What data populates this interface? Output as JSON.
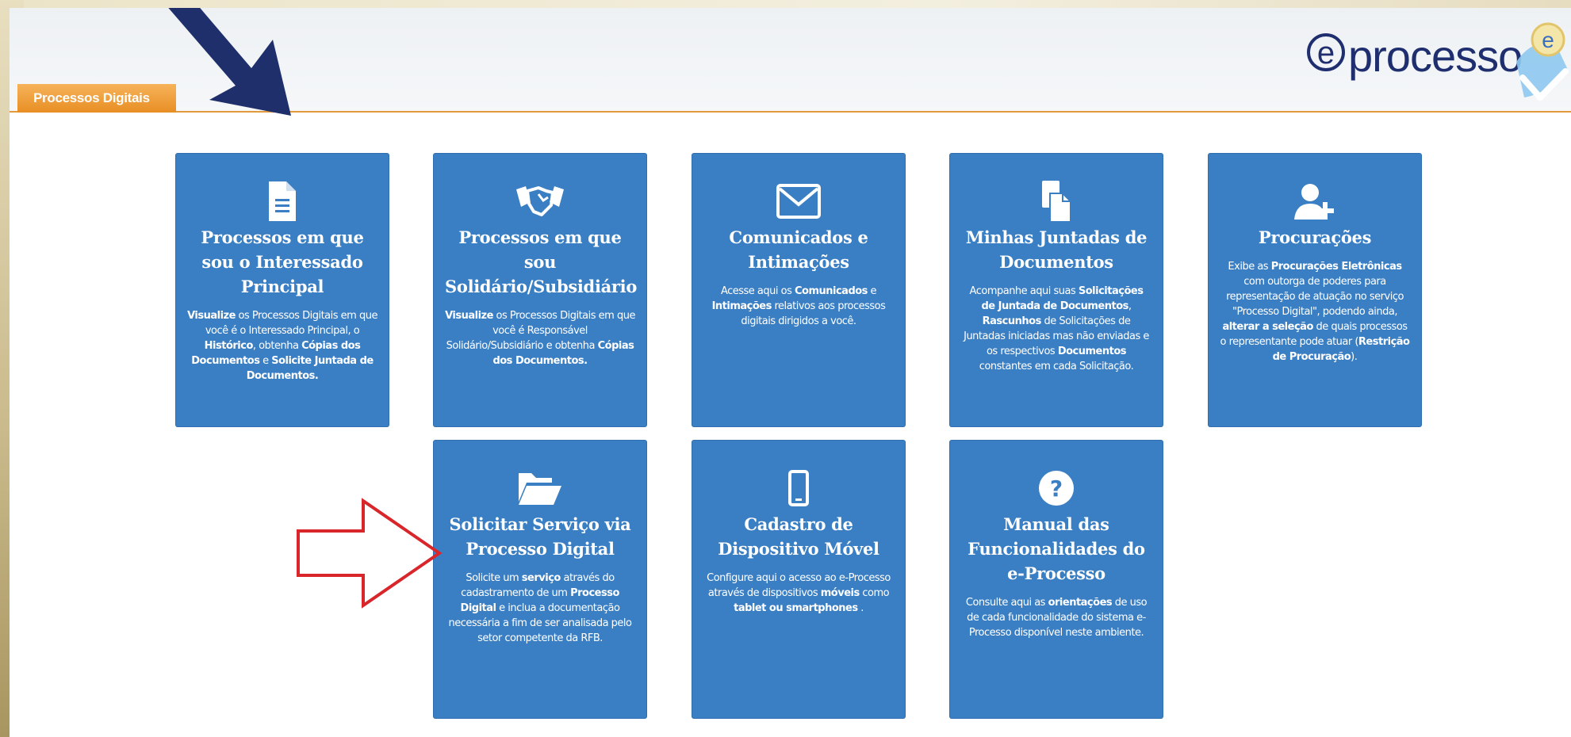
{
  "tab": {
    "label": "Processos Digitais"
  },
  "logo": {
    "text": "eprocesso"
  },
  "cards": [
    {
      "title": "Processos em que sou o Interessado Principal",
      "desc": [
        {
          "t": "Visualize",
          "b": true
        },
        {
          "t": " os Processos Digitais em que você é o Interessado Principal, o ",
          "b": false
        },
        {
          "t": "Histórico",
          "b": true
        },
        {
          "t": ", obtenha ",
          "b": false
        },
        {
          "t": "Cópias dos Documentos",
          "b": true
        },
        {
          "t": " e ",
          "b": false
        },
        {
          "t": "Solicite Juntada de Documentos.",
          "b": true
        }
      ]
    },
    {
      "title": "Processos em que sou Solidário/Subsidiário",
      "desc": [
        {
          "t": "Visualize",
          "b": true
        },
        {
          "t": " os Processos Digitais em que você é Responsável Solidário/Subsidiário e obtenha ",
          "b": false
        },
        {
          "t": "Cópias dos Documentos.",
          "b": true
        }
      ]
    },
    {
      "title": "Comunicados e Intimações",
      "desc": [
        {
          "t": "Acesse aqui os ",
          "b": false
        },
        {
          "t": "Comunicados",
          "b": true
        },
        {
          "t": " e ",
          "b": false
        },
        {
          "t": "Intimações",
          "b": true
        },
        {
          "t": " relativos aos processos digitais dirigidos a você.",
          "b": false
        }
      ]
    },
    {
      "title": "Minhas Juntadas de Documentos",
      "desc": [
        {
          "t": "Acompanhe aqui suas ",
          "b": false
        },
        {
          "t": "Solicitações de Juntada de Documentos",
          "b": true
        },
        {
          "t": ", ",
          "b": false
        },
        {
          "t": "Rascunhos",
          "b": true
        },
        {
          "t": " de Solicitações de Juntadas iniciadas mas não enviadas e os respectivos ",
          "b": false
        },
        {
          "t": "Documentos",
          "b": true
        },
        {
          "t": " constantes em cada Solicitação.",
          "b": false
        }
      ]
    },
    {
      "title": "Procurações",
      "desc": [
        {
          "t": "Exibe as ",
          "b": false
        },
        {
          "t": "Procurações Eletrônicas",
          "b": true
        },
        {
          "t": " com outorga de poderes para representação de atuação no serviço \"Processo Digital\", podendo ainda, ",
          "b": false
        },
        {
          "t": "alterar a seleção",
          "b": true
        },
        {
          "t": " de quais processos o representante pode atuar (",
          "b": false
        },
        {
          "t": "Restrição de Procuração",
          "b": true
        },
        {
          "t": ").",
          "b": false
        }
      ]
    },
    {
      "title": "Solicitar Serviço via Processo Digital",
      "desc": [
        {
          "t": "Solicite um ",
          "b": false
        },
        {
          "t": "serviço",
          "b": true
        },
        {
          "t": " através do cadastramento de um ",
          "b": false
        },
        {
          "t": "Processo Digital",
          "b": true
        },
        {
          "t": " e inclua a documentação necessária a fim de ser analisada pelo setor competente da RFB.",
          "b": false
        }
      ]
    },
    {
      "title": "Cadastro de Dispositivo Móvel",
      "desc": [
        {
          "t": "Configure aqui o acesso ao e-Processo através de dispositivos ",
          "b": false
        },
        {
          "t": "móveis",
          "b": true
        },
        {
          "t": " como ",
          "b": false
        },
        {
          "t": "tablet ou smartphones",
          "b": true
        },
        {
          "t": " .",
          "b": false
        }
      ]
    },
    {
      "title": "Manual das Funcionalidades do e-Processo",
      "desc": [
        {
          "t": "Consulte aqui as ",
          "b": false
        },
        {
          "t": "orientações",
          "b": true
        },
        {
          "t": " de uso de cada funcionalidade do sistema e-Processo disponível neste ambiente.",
          "b": false
        }
      ]
    }
  ],
  "colors": {
    "card": "#3a7fc4",
    "tab": "#e88f24",
    "header_line": "#e29a3c",
    "arrow_blue": "#1f2f6b",
    "arrow_red": "#d8262a"
  }
}
